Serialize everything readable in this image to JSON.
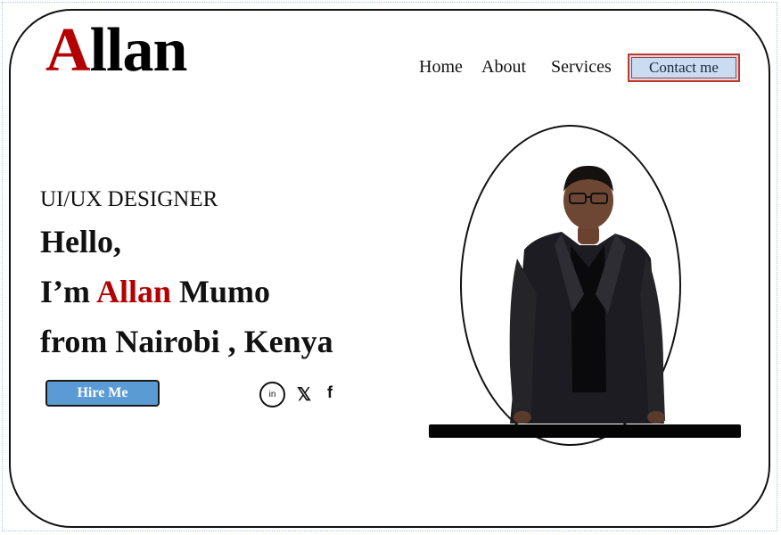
{
  "logo": {
    "first_letter": "A",
    "rest": "llan"
  },
  "nav": {
    "home": "Home",
    "about": "About",
    "services": "Services",
    "contact": "Contact me"
  },
  "hero": {
    "role": "UI/UX DESIGNER",
    "greeting": "Hello,",
    "intro_prefix": "I’m ",
    "first_name": "Allan",
    "last_name": " Mumo",
    "location": "from Nairobi , Kenya",
    "cta": "Hire  Me"
  },
  "social": {
    "linkedin_text": "in",
    "x_text": "𝕏",
    "facebook_text": "f"
  },
  "colors": {
    "accent_red": "#b30000",
    "button_blue": "#5b9bd5",
    "contact_bg": "#c9dcf2"
  },
  "icons": [
    "linkedin-icon",
    "x-icon",
    "facebook-icon"
  ]
}
